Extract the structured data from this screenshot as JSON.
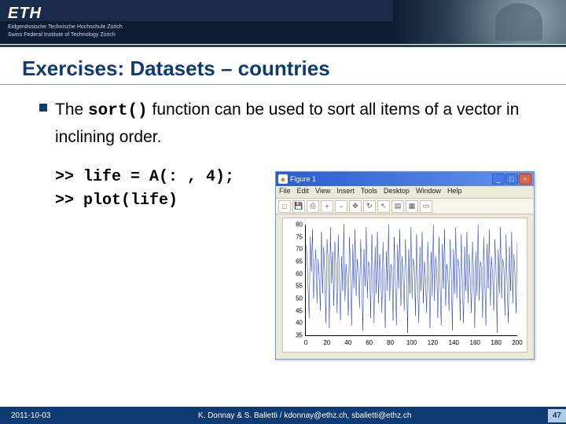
{
  "header": {
    "logo": "ETH",
    "sub_line1": "Eidgenössische Technische Hochschule Zürich",
    "sub_line2": "Swiss Federal Institute of Technology Zurich"
  },
  "title": "Exercises: Datasets – countries",
  "bullet": {
    "pre": "The ",
    "code": "sort()",
    "post": "  function can be used to sort all items of a vector in inclining order."
  },
  "code": {
    "line1": ">> life = A(: , 4);",
    "line2": ">> plot(life)"
  },
  "figure": {
    "title": "Figure 1",
    "menu": [
      "File",
      "Edit",
      "View",
      "Insert",
      "Tools",
      "Desktop",
      "Window",
      "Help"
    ],
    "toolbar_icons": [
      "file-new-icon",
      "save-icon",
      "print-icon",
      "zoom-in-icon",
      "zoom-out-icon",
      "pan-icon",
      "rotate-icon",
      "cursor-icon",
      "colorbar-icon",
      "legend-icon",
      "box-icon"
    ],
    "yticks": [
      "35",
      "40",
      "45",
      "50",
      "55",
      "60",
      "65",
      "70",
      "75",
      "80"
    ],
    "xticks": [
      "0",
      "20",
      "40",
      "60",
      "80",
      "100",
      "120",
      "140",
      "160",
      "180",
      "200"
    ]
  },
  "chart_data": {
    "type": "line",
    "title": "",
    "xlabel": "",
    "ylabel": "",
    "xlim": [
      0,
      200
    ],
    "ylim": [
      35,
      80
    ],
    "x_count": 190,
    "values": [
      72,
      68,
      55,
      42,
      75,
      61,
      78,
      50,
      63,
      70,
      48,
      66,
      59,
      45,
      77,
      52,
      71,
      60,
      40,
      74,
      65,
      38,
      79,
      56,
      69,
      47,
      73,
      62,
      44,
      76,
      58,
      41,
      67,
      53,
      80,
      49,
      64,
      57,
      43,
      75,
      60,
      39,
      72,
      54,
      78,
      51,
      66,
      61,
      46,
      74,
      59,
      37,
      70,
      55,
      79,
      50,
      65,
      63,
      42,
      76,
      58,
      40,
      71,
      52,
      77,
      48,
      68,
      60,
      44,
      73,
      56,
      38,
      69,
      53,
      80,
      49,
      64,
      62,
      41,
      75,
      57,
      39,
      72,
      54,
      78,
      47,
      67,
      59,
      45,
      74,
      61,
      36,
      70,
      52,
      79,
      50,
      66,
      63,
      43,
      76,
      55,
      40,
      71,
      53,
      77,
      48,
      65,
      58,
      44,
      73,
      60,
      38,
      69,
      51,
      80,
      49,
      67,
      62,
      42,
      75,
      56,
      39,
      72,
      54,
      78,
      47,
      64,
      59,
      45,
      74,
      61,
      37,
      70,
      52,
      79,
      50,
      66,
      63,
      41,
      76,
      55,
      40,
      71,
      53,
      77,
      48,
      68,
      58,
      44,
      73,
      60,
      38,
      69,
      51,
      80,
      49,
      65,
      62,
      42,
      75,
      56,
      39,
      72,
      54,
      78,
      47,
      67,
      59,
      45,
      74,
      61,
      36,
      70,
      52,
      79,
      50,
      66,
      63,
      43,
      76,
      55,
      40,
      71,
      53,
      77,
      48,
      68,
      60,
      44,
      73
    ]
  },
  "footer": {
    "date": "2011-10-03",
    "authors": "K. Donnay & S. Balietti / kdonnay@ethz.ch, sbalietti@ethz.ch",
    "page": "47"
  }
}
